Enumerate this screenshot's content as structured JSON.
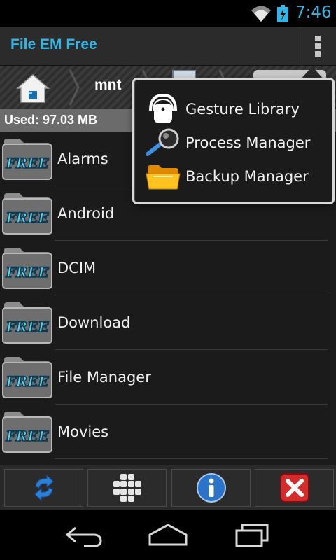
{
  "status_bar": {
    "time": "7:46",
    "icons": [
      "wifi-icon",
      "battery-charging-icon"
    ]
  },
  "action_bar": {
    "title": "File EM Free",
    "overflow_icon": "overflow-menu-icon"
  },
  "path_bar": {
    "home_icon": "home-icon",
    "current_folder": "mnt"
  },
  "storage": {
    "used_label": "Used: 97.03 MB"
  },
  "files": [
    {
      "name": "Alarms",
      "icon": "folder-free-icon"
    },
    {
      "name": "Android",
      "icon": "folder-free-icon"
    },
    {
      "name": "DCIM",
      "icon": "folder-free-icon"
    },
    {
      "name": "Download",
      "icon": "folder-free-icon"
    },
    {
      "name": "File Manager",
      "icon": "folder-free-icon"
    },
    {
      "name": "Movies",
      "icon": "folder-free-icon"
    }
  ],
  "folder_badge_text": "FREE",
  "toolbar": {
    "buttons": [
      {
        "name": "refresh",
        "icon": "refresh-icon"
      },
      {
        "name": "grid",
        "icon": "grid-icon"
      },
      {
        "name": "info",
        "icon": "info-icon"
      },
      {
        "name": "close",
        "icon": "close-icon"
      }
    ]
  },
  "popup_menu": {
    "items": [
      {
        "label": "Gesture Library",
        "icon": "gesture-lock-icon"
      },
      {
        "label": "Process Manager",
        "icon": "magnifier-icon"
      },
      {
        "label": "Backup Manager",
        "icon": "folder-open-icon"
      }
    ]
  },
  "colors": {
    "accent": "#33b5e5",
    "folder_badge": "#5fd1e6"
  },
  "nav_bar": {
    "icons": [
      "back-icon",
      "home-nav-icon",
      "recents-icon"
    ]
  }
}
